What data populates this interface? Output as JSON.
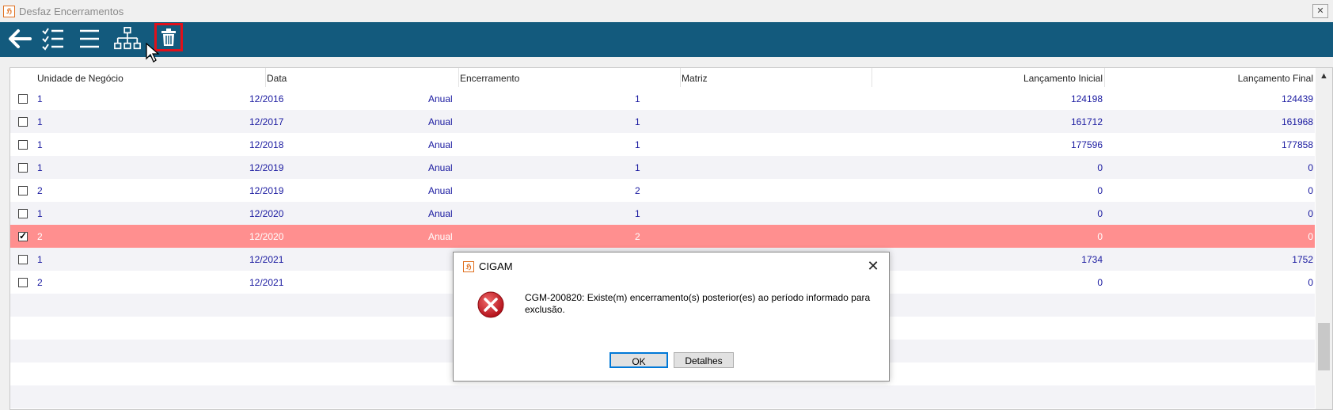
{
  "window": {
    "title": "Desfaz Encerramentos",
    "close_glyph": "✕"
  },
  "toolbar": {
    "buttons": [
      {
        "name": "back-arrow-icon"
      },
      {
        "name": "checklist-icon"
      },
      {
        "name": "list-icon"
      },
      {
        "name": "hierarchy-icon"
      },
      {
        "name": "trash-icon",
        "highlighted": true
      }
    ],
    "background": "#135a7d",
    "highlight_color": "#e0101a"
  },
  "grid": {
    "columns": [
      "Unidade de Negócio",
      "Data",
      "Encerramento",
      "Matriz",
      "Lançamento Inicial",
      "Lançamento Final"
    ],
    "rows": [
      {
        "checked": false,
        "unidade": "1",
        "data": "12/2016",
        "enc": "Anual",
        "matriz": "1",
        "inicial": "124198",
        "final": "124439"
      },
      {
        "checked": false,
        "unidade": "1",
        "data": "12/2017",
        "enc": "Anual",
        "matriz": "1",
        "inicial": "161712",
        "final": "161968"
      },
      {
        "checked": false,
        "unidade": "1",
        "data": "12/2018",
        "enc": "Anual",
        "matriz": "1",
        "inicial": "177596",
        "final": "177858"
      },
      {
        "checked": false,
        "unidade": "1",
        "data": "12/2019",
        "enc": "Anual",
        "matriz": "1",
        "inicial": "0",
        "final": "0"
      },
      {
        "checked": false,
        "unidade": "2",
        "data": "12/2019",
        "enc": "Anual",
        "matriz": "2",
        "inicial": "0",
        "final": "0"
      },
      {
        "checked": false,
        "unidade": "1",
        "data": "12/2020",
        "enc": "Anual",
        "matriz": "1",
        "inicial": "0",
        "final": "0"
      },
      {
        "checked": true,
        "unidade": "2",
        "data": "12/2020",
        "enc": "Anual",
        "matriz": "2",
        "inicial": "0",
        "final": "0"
      },
      {
        "checked": false,
        "unidade": "1",
        "data": "12/2021",
        "enc": "",
        "matriz": "",
        "inicial": "1734",
        "final": "1752"
      },
      {
        "checked": false,
        "unidade": "2",
        "data": "12/2021",
        "enc": "",
        "matriz": "",
        "inicial": "0",
        "final": "0"
      }
    ],
    "empty_rows": 5,
    "selected_color": "#ff8f8f",
    "text_color": "#1a1aa0"
  },
  "dialog": {
    "title": "CIGAM",
    "message": "CGM-200820: Existe(m) encerramento(s) posterior(es) ao período informado para exclusão.",
    "ok_label": "OK",
    "details_label": "Detalhes",
    "icon": "error-icon"
  }
}
